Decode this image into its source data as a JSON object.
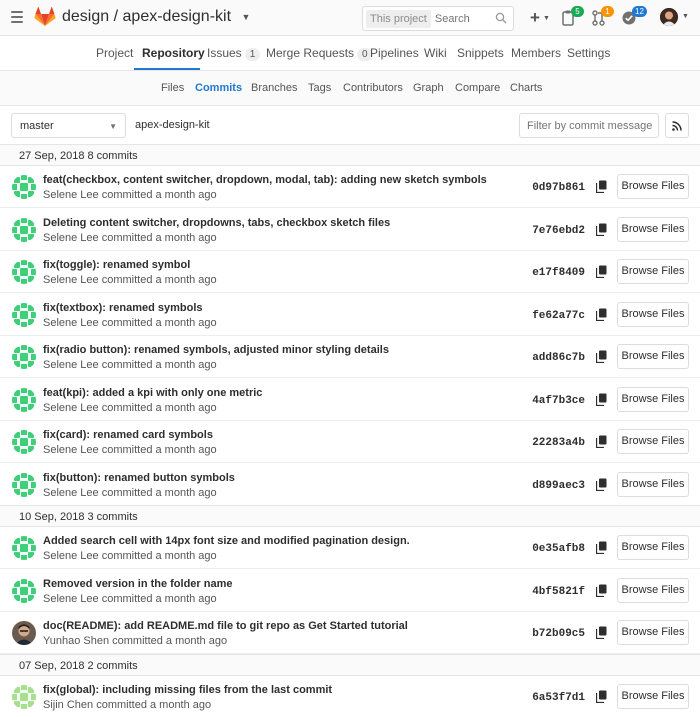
{
  "header": {
    "group": "design",
    "separator": "/",
    "project": "apex-design-kit",
    "search_scope": "This project",
    "search_placeholder": "Search",
    "badges": {
      "issues_count": "5",
      "merge_requests_count": "1",
      "todos_count": "12"
    }
  },
  "nav_primary": {
    "items": [
      {
        "label": "Project"
      },
      {
        "label": "Repository"
      },
      {
        "label": "Issues",
        "count": "1"
      },
      {
        "label": "Merge Requests",
        "count": "0"
      },
      {
        "label": "Pipelines"
      },
      {
        "label": "Wiki"
      },
      {
        "label": "Snippets"
      },
      {
        "label": "Members"
      },
      {
        "label": "Settings"
      }
    ],
    "active": "Repository"
  },
  "nav_secondary": {
    "items": [
      {
        "label": "Files"
      },
      {
        "label": "Commits"
      },
      {
        "label": "Branches"
      },
      {
        "label": "Tags"
      },
      {
        "label": "Contributors"
      },
      {
        "label": "Graph"
      },
      {
        "label": "Compare"
      },
      {
        "label": "Charts"
      }
    ],
    "active": "Commits"
  },
  "toolbar": {
    "branch": "master",
    "project_name": "apex-design-kit",
    "filter_placeholder": "Filter by commit message"
  },
  "commit_groups": [
    {
      "label": "27 Sep, 2018 8 commits",
      "commits": [
        {
          "message": "feat(checkbox, content switcher, dropdown, modal, tab): adding new sketch symbols",
          "author": "Selene Lee committed a month ago",
          "sha": "0d97b861",
          "browse_label": "Browse Files"
        },
        {
          "message": "Deleting content switcher, dropdowns, tabs, checkbox sketch files",
          "author": "Selene Lee committed a month ago",
          "sha": "7e76ebd2",
          "browse_label": "Browse Files"
        },
        {
          "message": "fix(toggle): renamed symbol",
          "author": "Selene Lee committed a month ago",
          "sha": "e17f8409",
          "browse_label": "Browse Files"
        },
        {
          "message": "fix(textbox): renamed symbols",
          "author": "Selene Lee committed a month ago",
          "sha": "fe62a77c",
          "browse_label": "Browse Files"
        },
        {
          "message": "fix(radio button): renamed symbols, adjusted minor styling details",
          "author": "Selene Lee committed a month ago",
          "sha": "add86c7b",
          "browse_label": "Browse Files"
        },
        {
          "message": "feat(kpi): added a kpi with only one metric",
          "author": "Selene Lee committed a month ago",
          "sha": "4af7b3ce",
          "browse_label": "Browse Files"
        },
        {
          "message": "fix(card): renamed card symbols",
          "author": "Selene Lee committed a month ago",
          "sha": "22283a4b",
          "browse_label": "Browse Files"
        },
        {
          "message": "fix(button): renamed button symbols",
          "author": "Selene Lee committed a month ago",
          "sha": "d899aec3",
          "browse_label": "Browse Files"
        }
      ]
    },
    {
      "label": "10 Sep, 2018 3 commits",
      "commits": [
        {
          "message": "Added search cell with 14px font size and modified pagination design.",
          "author": "Selene Lee committed a month ago",
          "sha": "0e35afb8",
          "browse_label": "Browse Files"
        },
        {
          "message": "Removed version in the folder name",
          "author": "Selene Lee committed a month ago",
          "sha": "4bf5821f",
          "browse_label": "Browse Files"
        },
        {
          "message": "doc(README): add README.md file to git repo as Get Started tutorial",
          "author": "Yunhao Shen committed a month ago",
          "sha": "b72b09c5",
          "browse_label": "Browse Files"
        }
      ]
    },
    {
      "label": "07 Sep, 2018 2 commits",
      "commits": [
        {
          "message": "fix(global): including missing files from the last commit",
          "author": "Sijin Chen committed a month ago",
          "sha": "6a53f7d1",
          "browse_label": "Browse Files"
        }
      ]
    }
  ],
  "colors": {
    "accent": "#1f78d1",
    "identicon_green": "#3fce7a",
    "identicon_lightgreen": "#a6e08a",
    "badge_green": "#1aaa55",
    "badge_orange": "#fc9403",
    "badge_blue": "#1f78d1"
  }
}
